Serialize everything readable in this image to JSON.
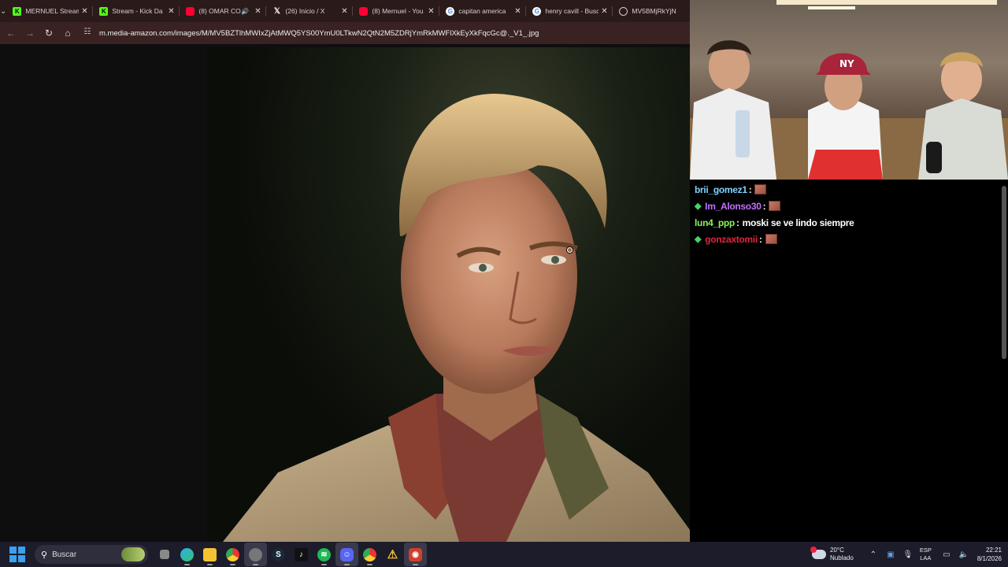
{
  "browser": {
    "tabs": [
      {
        "title": "MERNUEL Stream",
        "favicon": "kick-icon",
        "close": "✕"
      },
      {
        "title": "Stream - Kick Da",
        "favicon": "kick-icon",
        "close": "✕"
      },
      {
        "title": "(8) OMAR CO",
        "favicon": "youtube-icon",
        "audio": true,
        "close": "✕"
      },
      {
        "title": "(26) Inicio / X",
        "favicon": "x-icon",
        "close": "✕"
      },
      {
        "title": "(8) Mernuel - You",
        "favicon": "youtube-icon",
        "close": "✕"
      },
      {
        "title": "capitan america",
        "favicon": "google-icon",
        "close": "✕"
      },
      {
        "title": "henry cavill - Busc",
        "favicon": "google-icon",
        "close": "✕"
      },
      {
        "title": "MV5BMjRkYjN",
        "favicon": "globe-icon"
      }
    ],
    "url": "m.media-amazon.com/images/M/MV5BZTlhMWIxZjAtMWQ5YS00YmU0LTkwN2QtN2M5ZDRjYmRkMWFlXkEyXkFqcGc@._V1_.jpg"
  },
  "chat": {
    "messages": [
      {
        "user": "brii_gomez1",
        "color": "#7fd3ff",
        "badge": false,
        "emote": true,
        "text": ""
      },
      {
        "user": "Im_Alonso30",
        "color": "#c070ff",
        "badge": true,
        "emote": true,
        "text": ""
      },
      {
        "user": "lun4_ppp",
        "color": "#8cf05a",
        "badge": false,
        "emote": false,
        "text": "moski se ve lindo siempre"
      },
      {
        "user": "gonzaxtomii",
        "color": "#e0243c",
        "badge": true,
        "emote": true,
        "text": ""
      }
    ]
  },
  "taskbar": {
    "search_placeholder": "Buscar",
    "weather": {
      "temp": "20°C",
      "condition": "Nublado"
    },
    "language": {
      "code": "ESP",
      "layout": "LAA"
    },
    "time": "22:21",
    "date": "8/1/2026"
  }
}
